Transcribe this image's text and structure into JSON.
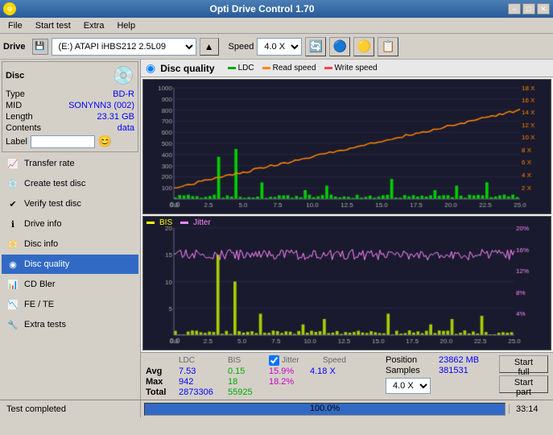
{
  "titlebar": {
    "title": "Opti Drive Control 1.70",
    "min": "–",
    "max": "□",
    "close": "✕"
  },
  "menubar": {
    "items": [
      "File",
      "Start test",
      "Extra",
      "Help"
    ]
  },
  "drivebar": {
    "label": "Drive",
    "drive_value": "(E:) ATAPI iHBS212  2.5L09",
    "speed_label": "Speed",
    "speed_value": "4.0 X"
  },
  "disc": {
    "header": "Disc",
    "type_label": "Type",
    "type_value": "BD-R",
    "mid_label": "MID",
    "mid_value": "SONYNN3 (002)",
    "length_label": "Length",
    "length_value": "23.31 GB",
    "contents_label": "Contents",
    "contents_value": "data",
    "label_label": "Label"
  },
  "sidebar": {
    "items": [
      {
        "id": "transfer-rate",
        "label": "Transfer rate",
        "icon": "📈"
      },
      {
        "id": "create-test",
        "label": "Create test disc",
        "icon": "💿"
      },
      {
        "id": "verify-test",
        "label": "Verify test disc",
        "icon": "✔"
      },
      {
        "id": "drive-info",
        "label": "Drive info",
        "icon": "ℹ"
      },
      {
        "id": "disc-info",
        "label": "Disc info",
        "icon": "📀"
      },
      {
        "id": "disc-quality",
        "label": "Disc quality",
        "icon": "◉",
        "active": true
      },
      {
        "id": "cd-bler",
        "label": "CD Bler",
        "icon": "📊"
      },
      {
        "id": "fe-te",
        "label": "FE / TE",
        "icon": "📉"
      },
      {
        "id": "extra-tests",
        "label": "Extra tests",
        "icon": "🔧"
      }
    ]
  },
  "dq": {
    "title": "Disc quality",
    "legend": [
      {
        "label": "LDC",
        "color": "#00aa00"
      },
      {
        "label": "Read speed",
        "color": "#ff6600"
      },
      {
        "label": "Write speed",
        "color": "#cc0000"
      }
    ],
    "legend2": [
      {
        "label": "BIS",
        "color": "#ffff00"
      },
      {
        "label": "Jitter",
        "color": "#ff88ff"
      }
    ]
  },
  "stats": {
    "col_ldc": "LDC",
    "col_bis": "BIS",
    "col_jitter": "Jitter",
    "col_speed": "Speed",
    "avg_ldc": "7.53",
    "avg_bis": "0.15",
    "avg_jitter": "15.9%",
    "avg_speed": "4.18 X",
    "max_ldc": "942",
    "max_bis": "18",
    "max_jitter": "18.2%",
    "total_ldc": "2873306",
    "total_bis": "55925",
    "position_label": "Position",
    "position_value": "23862 MB",
    "samples_label": "Samples",
    "samples_value": "381531",
    "speed_select": "4.0 X",
    "start_full": "Start full",
    "start_part": "Start part",
    "avg_label": "Avg",
    "max_label": "Max",
    "total_label": "Total"
  },
  "statusbar": {
    "status_text": "Test completed",
    "progress_percent": "100.0%",
    "progress_value": 100,
    "time": "33:14"
  }
}
